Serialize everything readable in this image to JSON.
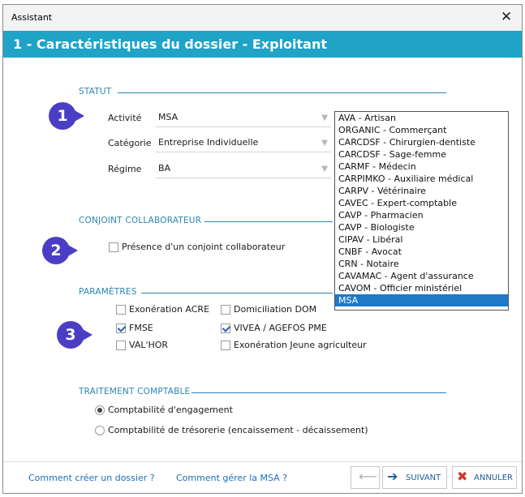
{
  "window": {
    "title": "Assistant",
    "close_glyph": "✕"
  },
  "header": {
    "title": "1 - Caractéristiques du dossier - Exploitant"
  },
  "statut": {
    "section_label": "STATUT",
    "activite_label": "Activité",
    "activite_value": "MSA",
    "categorie_label": "Catégorie",
    "categorie_value": "Entreprise Individuelle",
    "regime_label": "Régime",
    "regime_value": "BA"
  },
  "dropdown": {
    "options": [
      "AVA - Artisan",
      "ORGANIC - Commerçant",
      "CARCDSF - Chirurgien-dentiste",
      "CARCDSF - Sage-femme",
      "CARMF - Médecin",
      "CARPIMKO - Auxiliaire médical",
      "CARPV - Vétérinaire",
      "CAVEC - Expert-comptable",
      "CAVP - Pharmacien",
      "CAVP - Biologiste",
      "CIPAV - Libéral",
      "CNBF - Avocat",
      "CRN - Notaire",
      "CAVAMAC - Agent d'assurance",
      "CAVOM - Officier ministériel",
      "MSA"
    ],
    "selected": "MSA"
  },
  "conjoint": {
    "section_label": "CONJOINT COLLABORATEUR",
    "presence_label": "Présence d'un conjoint collaborateur"
  },
  "parametres": {
    "section_label": "PARAMÈTRES",
    "exoneration_acre": "Exonération ACRE",
    "domiciliation_dom": "Domiciliation DOM",
    "fmse": "FMSE",
    "vivea": "VIVEA / AGEFOS PME",
    "valhor": "VAL'HOR",
    "exoneration_jeune": "Exonération Jeune agriculteur"
  },
  "traitement": {
    "section_label": "TRAITEMENT COMPTABLE",
    "engagement": "Comptabilité d'engagement",
    "tresorerie": "Comptabilité de trésorerie (encaissement - décaissement)"
  },
  "badges": {
    "one": "1",
    "two": "2",
    "three": "3"
  },
  "footer": {
    "link_creer": "Comment créer un dossier ?",
    "link_msa": "Comment gérer la MSA ?",
    "suivant": "SUIVANT",
    "annuler": "ANNULER"
  },
  "colors": {
    "accent": "#1fa3c7",
    "badge": "#4a3fc4",
    "selection": "#1e79c9"
  }
}
